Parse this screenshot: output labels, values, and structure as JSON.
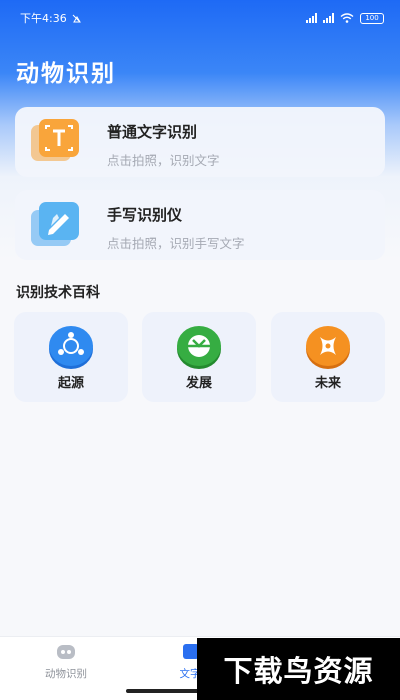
{
  "status_bar": {
    "time": "下午4:36",
    "battery": "100",
    "icons": [
      "alarm-icon",
      "signal-icon",
      "wifi-icon",
      "battery-icon"
    ]
  },
  "header": {
    "title": "动物识别"
  },
  "cards": [
    {
      "title": "普通文字识别",
      "subtitle": "点击拍照，识别文字",
      "icon": "text-scan-icon"
    },
    {
      "title": "手写识别仪",
      "subtitle": "点击拍照，识别手写文字",
      "icon": "handwriting-pen-icon"
    }
  ],
  "section": {
    "title": "识别技术百科"
  },
  "tiles": [
    {
      "label": "起源",
      "icon": "origin-icon",
      "color": "#2f8af0"
    },
    {
      "label": "发展",
      "icon": "development-icon",
      "color": "#2fa63c"
    },
    {
      "label": "未来",
      "icon": "future-icon",
      "color": "#f28b1d"
    }
  ],
  "tabbar": {
    "tabs": [
      {
        "label": "动物识别",
        "icon": "animal-tab-icon"
      },
      {
        "label": "文字",
        "icon": "text-tab-icon"
      }
    ]
  },
  "watermark": {
    "text": "下载鸟资源"
  },
  "colors": {
    "accent": "#1e6af5",
    "active_tab": "#2a6ff0"
  }
}
